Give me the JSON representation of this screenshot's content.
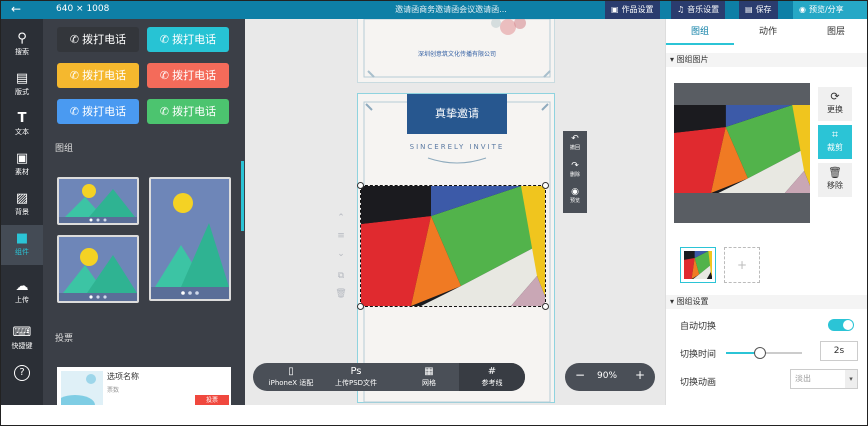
{
  "topbar": {
    "back_icon": "←",
    "size_label": "640 × 1008",
    "title": "邀请函商务邀请函会议邀请函...",
    "buttons": [
      "作品设置",
      "音乐设置",
      "保存",
      "预览/分享"
    ]
  },
  "iconbar": {
    "items": [
      {
        "glyph": "⚲",
        "label": "搜索",
        "icon": "search-icon"
      },
      {
        "glyph": "▤",
        "label": "版式",
        "icon": "layout-icon"
      },
      {
        "glyph": "T",
        "label": "文本",
        "icon": "text-icon"
      },
      {
        "glyph": "▣",
        "label": "素材",
        "icon": "image-icon"
      },
      {
        "glyph": "▨",
        "label": "背景",
        "icon": "background-icon"
      },
      {
        "glyph": "■",
        "label": "组件",
        "icon": "component-icon"
      },
      {
        "glyph": "☁",
        "label": "上传",
        "icon": "upload-icon"
      },
      {
        "glyph": "⌨",
        "label": "快捷键",
        "icon": "keyboard-icon"
      },
      {
        "glyph": "?",
        "label": "",
        "icon": "help-icon"
      }
    ]
  },
  "panel": {
    "call_label": "拨打电话",
    "call_colors": [
      "#33363b",
      "#27c3d4",
      "#f5b82e",
      "#f46b5a",
      "#4a9af1",
      "#4cc46f"
    ],
    "gallery_heading": "图组",
    "vote_heading": "投票",
    "vote_card": {
      "option_name": "选项名称",
      "sub": "票数",
      "button": "投票"
    }
  },
  "canvas": {
    "top_page_text": "深圳创意筑文化传播有限公司",
    "banner_text": "真挚邀请",
    "sincerely": "SINCERELY INVITE",
    "float_toolbar": [
      "撤回",
      "删除",
      "预览"
    ],
    "bottom_tools": [
      {
        "glyph": "▯",
        "label": "iPhoneX 适配"
      },
      {
        "glyph": "Ps",
        "label": "上传PSD文件"
      },
      {
        "glyph": "▦",
        "label": "网格"
      },
      {
        "glyph": "#",
        "label": "参考线"
      }
    ],
    "zoom": "90%",
    "zoom_minus": "−",
    "zoom_plus": "+"
  },
  "rpanel": {
    "tabs": [
      "图组",
      "动作",
      "图层"
    ],
    "section_images": "图组图片",
    "side_buttons": [
      "更换",
      "裁剪",
      "移除"
    ],
    "add_thumb": "+",
    "section_settings": "图组设置",
    "auto_switch_label": "自动切换",
    "switch_time_label": "切换时间",
    "switch_time_value": "2s",
    "switch_time_fraction": 0.45,
    "switch_anim_label": "切换动画",
    "switch_anim_value": "淡出"
  }
}
